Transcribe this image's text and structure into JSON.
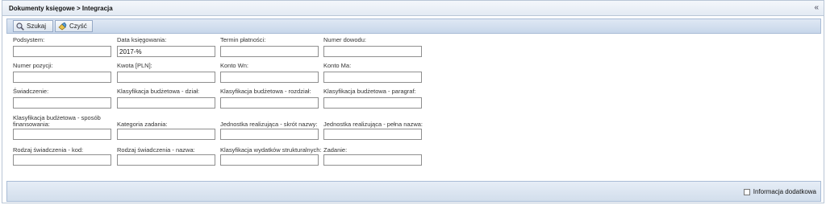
{
  "header": {
    "title": "Dokumenty księgowe > Integracja",
    "collapse_icon": "«"
  },
  "toolbar": {
    "search_label": "Szukaj",
    "clear_label": "Czyść"
  },
  "fields": {
    "podsystem": {
      "label": "Podsystem:",
      "value": ""
    },
    "data_ksiegowania": {
      "label": "Data księgowania:",
      "value": "2017-%"
    },
    "termin_platnosci": {
      "label": "Termin płatności:",
      "value": ""
    },
    "numer_dowodu": {
      "label": "Numer dowodu:",
      "value": ""
    },
    "numer_pozycji": {
      "label": "Numer pozycji:",
      "value": ""
    },
    "kwota": {
      "label": "Kwota [PLN]:",
      "value": ""
    },
    "konto_wn": {
      "label": "Konto Wn:",
      "value": ""
    },
    "konto_ma": {
      "label": "Konto Ma:",
      "value": ""
    },
    "swiadczenie": {
      "label": "Świadczenie:",
      "value": ""
    },
    "klas_dzial": {
      "label": "Klasyfikacja budżetowa - dział:",
      "value": ""
    },
    "klas_rozdzial": {
      "label": "Klasyfikacja budżetowa - rozdział:",
      "value": ""
    },
    "klas_paragraf": {
      "label": "Klasyfikacja budżetowa - paragraf:",
      "value": ""
    },
    "klas_sposob_1": {
      "label": "Klasyfikacja budżetowa - sposób",
      "value": ""
    },
    "klas_sposob_2": {
      "label": "finansowania:"
    },
    "kategoria_zadania": {
      "label": "Kategoria zadania:",
      "value": ""
    },
    "jedn_skrot": {
      "label": "Jednostka realizująca - skrót nazwy:",
      "value": ""
    },
    "jedn_pelna": {
      "label": "Jednostka realizująca - pełna nazwa:",
      "value": ""
    },
    "rodzaj_kod": {
      "label": "Rodzaj świadczenia - kod:",
      "value": ""
    },
    "rodzaj_nazwa": {
      "label": "Rodzaj świadczenia - nazwa:",
      "value": ""
    },
    "klas_wydatkow": {
      "label": "Klasyfikacja wydatków strukturalnych:",
      "value": ""
    },
    "zadanie": {
      "label": "Zadanie:",
      "value": ""
    }
  },
  "footer": {
    "info_label": "Informacja dodatkowa",
    "info_checked": false
  },
  "colors": {
    "accent": "#c7d6ea",
    "border": "#a9bcd6"
  }
}
